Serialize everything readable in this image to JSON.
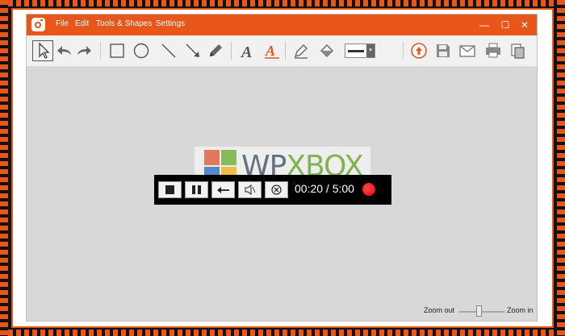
{
  "window": {
    "menu": [
      "File",
      "Edit",
      "Tools & Shapes",
      "Settings"
    ],
    "controls": {
      "minimize": "—",
      "maximize": "☐",
      "close": "✕"
    }
  },
  "toolbar": {
    "tools": [
      "pointer-icon",
      "undo-icon",
      "redo-icon",
      "rectangle-icon",
      "ellipse-icon",
      "line-icon",
      "arrow-icon",
      "pencil-icon",
      "text-icon",
      "text-outline-icon",
      "highlighter-icon",
      "fill-bucket-icon",
      "line-width-picker",
      "upload-icon",
      "save-icon",
      "email-icon",
      "print-icon",
      "copy-icon"
    ]
  },
  "canvas": {
    "logo": {
      "part1": "WP",
      "part2": "XBOX"
    }
  },
  "recorder": {
    "timer": "00:20 / 5:00",
    "buttons": [
      "stop-icon",
      "pause-icon",
      "back-icon",
      "mute-icon",
      "cancel-icon"
    ]
  },
  "zoom": {
    "out_label": "Zoom out",
    "in_label": "Zoom in",
    "level": 0.42
  },
  "colors": {
    "accent": "#e8561a",
    "record": "#e00000"
  }
}
